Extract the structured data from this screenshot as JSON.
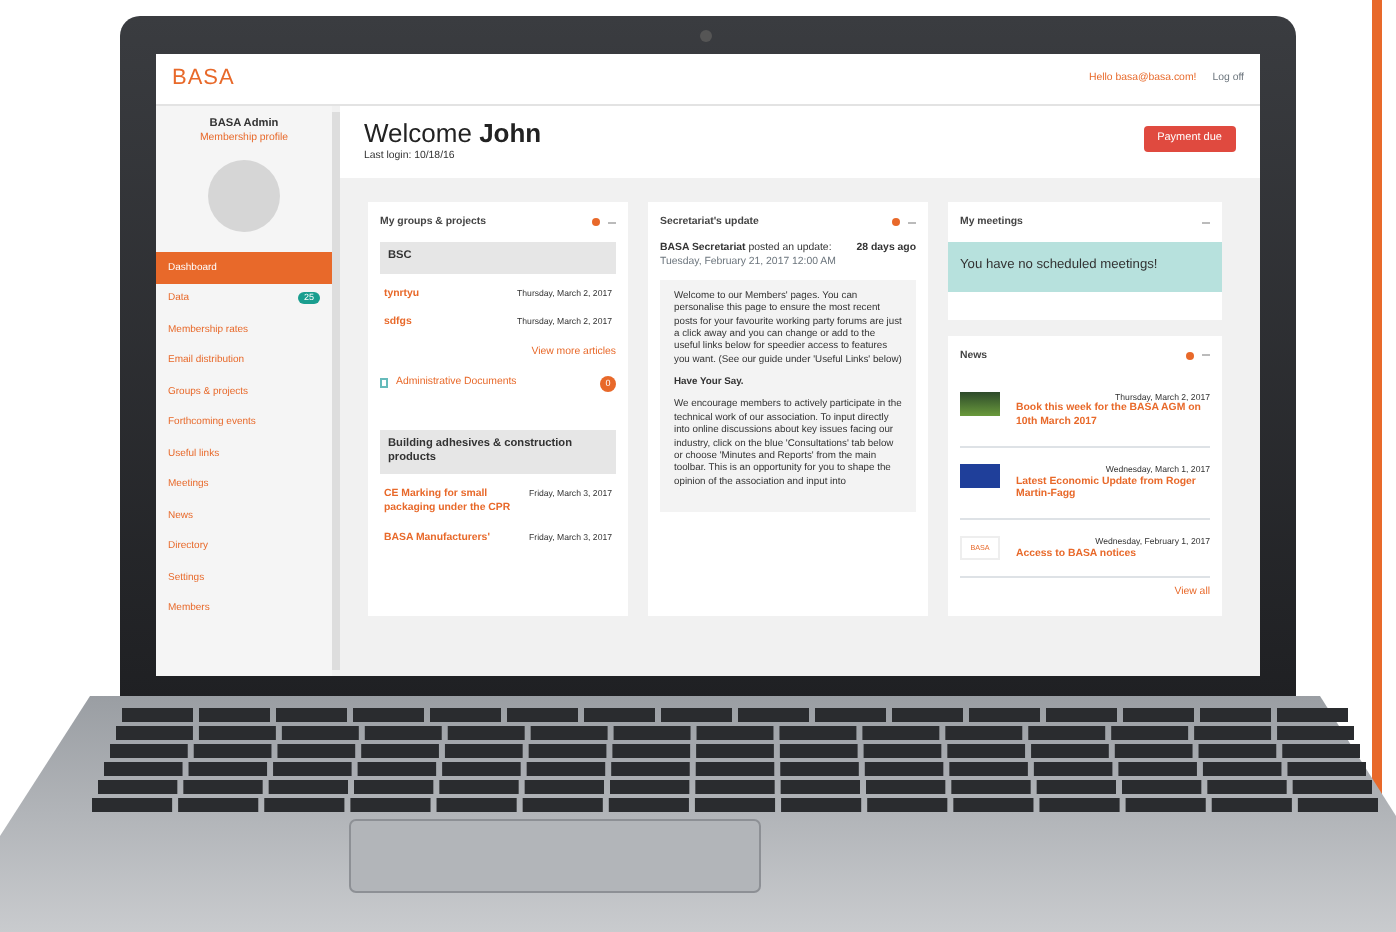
{
  "header": {
    "logo": "BASA",
    "greeting": "Hello basa@basa.com!",
    "logout": "Log off"
  },
  "sidebar": {
    "name": "BASA Admin",
    "profile_link": "Membership profile",
    "items": [
      {
        "label": "Dashboard",
        "selected": true
      },
      {
        "label": "Data",
        "selected": false,
        "badge": "25"
      },
      {
        "label": "Membership rates",
        "selected": false
      },
      {
        "label": "Email distribution",
        "selected": false
      },
      {
        "label": "Groups & projects",
        "selected": false
      },
      {
        "label": "Forthcoming events",
        "selected": false
      },
      {
        "label": "Useful links",
        "selected": false
      },
      {
        "label": "Meetings",
        "selected": false
      },
      {
        "label": "News",
        "selected": false
      },
      {
        "label": "Directory",
        "selected": false
      },
      {
        "label": "Settings",
        "selected": false
      },
      {
        "label": "Members",
        "selected": false
      }
    ]
  },
  "welcome": {
    "title": "Welcome **John**",
    "last_login": "Last login: 10/18/16",
    "button": "Payment due"
  },
  "groups_panel": {
    "title": "My groups & projects",
    "groups": [
      {
        "name": "BSC",
        "items": [
          {
            "title": "tynrtyu",
            "date": "Thursday, March 2, 2017"
          },
          {
            "title": "sdfgs",
            "date": "Thursday, March 2, 2017"
          }
        ],
        "more": "View more articles",
        "documents": {
          "label": "Administrative Documents",
          "count": "0"
        }
      },
      {
        "name": "Building adhesives & construction products",
        "items": [
          {
            "title": "CE Marking for small packaging under the CPR",
            "date": "Friday, March 3, 2017"
          },
          {
            "title": "BASA Manufacturers'",
            "date": "Friday, March 3, 2017"
          }
        ]
      }
    ]
  },
  "update_panel": {
    "title": "Secretariat's update",
    "byline": "**BASA Secretariat** posted an update:",
    "age": "28 days ago",
    "date": "Tuesday, February 21, 2017 12:00 AM",
    "paragraphs": [
      {
        "kind": "text",
        "text": "Welcome to our Members' pages. You can personalise this page to ensure the most recent posts for your favourite working party forums are just a click away and you can change or add to the useful links below for speedier access to features you want. (See our guide under 'Useful Links' below)"
      },
      {
        "kind": "heading",
        "text": "Have Your Say."
      },
      {
        "kind": "text",
        "text": "We encourage members to actively participate in the technical work of our association. To input directly into online discussions about key issues facing our industry, click on the blue 'Consultations' tab below or choose 'Minutes and Reports' from the main toolbar. This is an opportunity for you to shape the opinion of the association and input into"
      }
    ]
  },
  "meetings_panel": {
    "title": "My meetings",
    "message": "You have no scheduled meetings!"
  },
  "news_panel": {
    "title": "News",
    "items": [
      {
        "thumb": {
          "kind": "photo"
        },
        "title": "Book this week for the BASA AGM on 10th March 2017",
        "date": "Thursday, March 2, 2017"
      },
      {
        "thumb": {
          "kind": "flag"
        },
        "title": "Latest Economic Update from Roger Martin-Fagg",
        "date": "Wednesday, March 1, 2017"
      },
      {
        "thumb": {
          "kind": "logo",
          "text": "BASA"
        },
        "title": "Access to BASA notices",
        "date": "Wednesday, February 1, 2017"
      }
    ],
    "view_all": "View all"
  }
}
